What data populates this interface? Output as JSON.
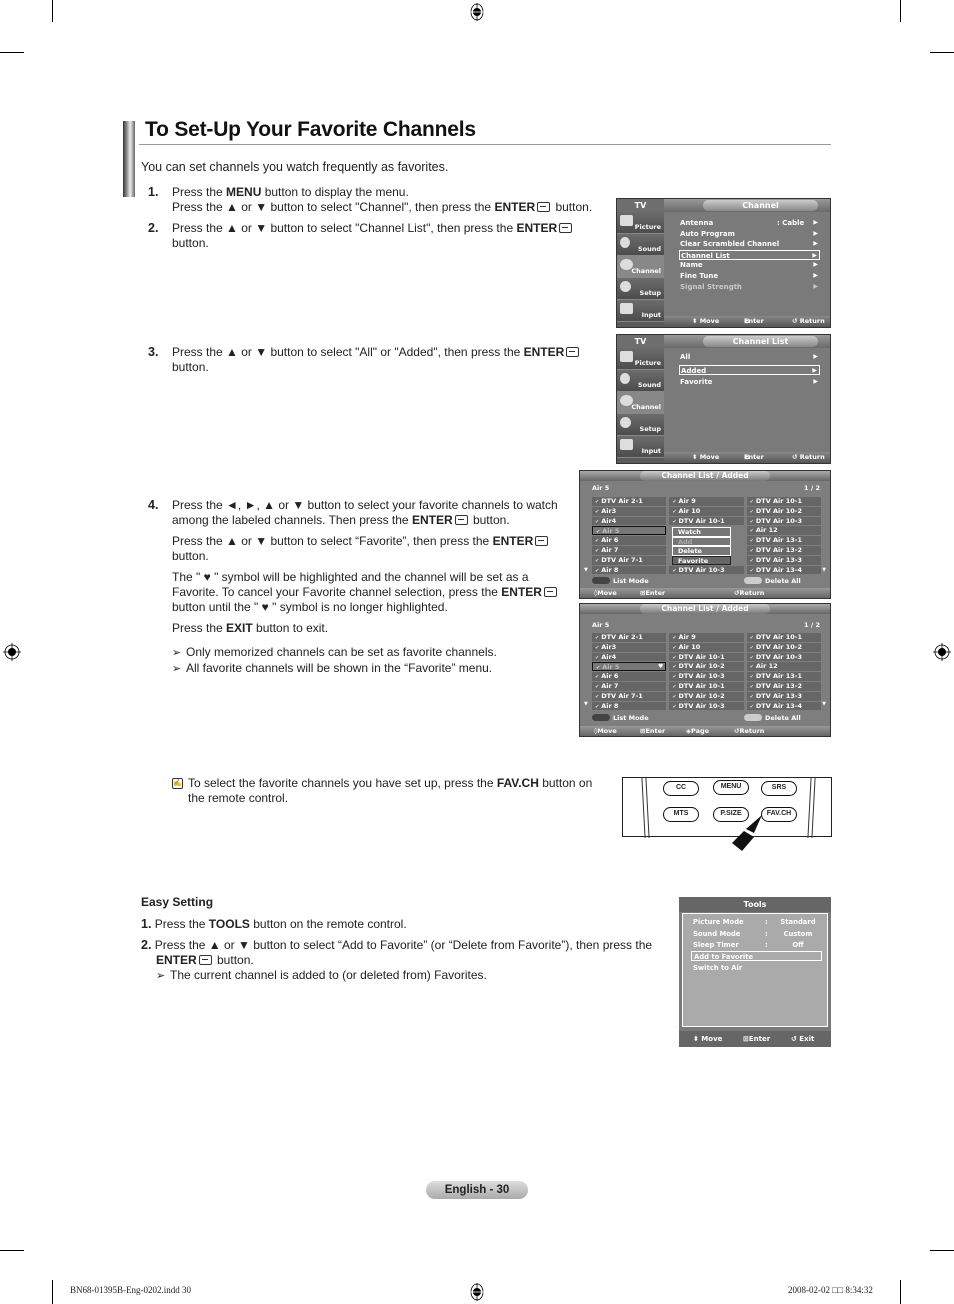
{
  "page": {
    "title": "To Set-Up Your Favorite Channels",
    "intro": "You can set channels you watch frequently as favorites.",
    "page_label": "English - 30",
    "slug_left": "BN68-01395B-Eng-0202.indd   30",
    "slug_right": "2008-02-02   □□ 8:34:32"
  },
  "steps": [
    {
      "num": "1.",
      "lines": [
        {
          "pre": "Press the ",
          "bold": "MENU",
          "post": " button to display the menu."
        },
        {
          "pre": "Press the ▲ or ▼ button to select \"Channel\", then press the ",
          "bold": "ENTER",
          "post": " button."
        }
      ]
    },
    {
      "num": "2.",
      "lines": [
        {
          "pre": "Press the ▲ or ▼ button to select \"Channel List\", then press the ",
          "bold": "ENTER",
          "post": " button."
        }
      ]
    },
    {
      "num": "3.",
      "lines": [
        {
          "pre": "Press the ▲ or ▼ button to select \"All\" or \"Added\", then press the ",
          "bold": "ENTER",
          "post": " button."
        }
      ]
    },
    {
      "num": "4.",
      "paras": [
        {
          "pre": "Press the  ◄, ►, ▲ or ▼ button to select your favorite channels to watch among the labeled channels. Then press the ",
          "bold": "ENTER",
          "post": " button."
        },
        {
          "pre": "Press the ▲ or ▼ button to select “Favorite”, then press the ",
          "bold": "ENTER",
          "post": " button."
        },
        {
          "pre": "The \" ♥ \" symbol will be highlighted and the channel will be set as a Favorite. To cancel your Favorite channel selection, press the ",
          "bold": "ENTER",
          "post": " button until the \" ♥ \" symbol is no longer highlighted."
        },
        {
          "pre": "Press the ",
          "bold": "EXIT",
          "post": " button to exit."
        }
      ],
      "notes": [
        "Only memorized channels can be set as favorite channels.",
        "All favorite channels will be shown in the “Favorite” menu."
      ]
    }
  ],
  "remote_note": {
    "pre": "To select the favorite channels you have set up, press the ",
    "bold": "FAV.CH",
    "post": " button on the remote control."
  },
  "easy_setting": {
    "heading": "Easy Setting",
    "step1": {
      "num": "1.",
      "pre": " Press the ",
      "bold": "TOOLS",
      "post": " button on the remote control."
    },
    "step2": {
      "num": "2.",
      "pre": " Press the ▲ or ▼ button to select “Add to Favorite” (or “Delete from Favorite”), then press the",
      "bold": "ENTER",
      "post": " button."
    },
    "note": "The current channel is added to (or deleted from) Favorites."
  },
  "osd_nav": [
    "Picture",
    "Sound",
    "Channel",
    "Setup",
    "Input"
  ],
  "osd_common": {
    "tv": "TV",
    "move": "⬍ Move",
    "enter": "Enter",
    "return": "↺ Return"
  },
  "osd_channel": {
    "title": "Channel",
    "items": [
      {
        "label": "Antenna",
        "value": ": Cable",
        "arrow": "▶"
      },
      {
        "label": "Auto Program",
        "value": "",
        "arrow": "▶"
      },
      {
        "label": "Clear Scrambled Channel",
        "value": "",
        "arrow": "▶"
      },
      {
        "label": "Channel List",
        "value": "",
        "arrow": "▶",
        "selected": true
      },
      {
        "label": "Name",
        "value": "",
        "arrow": "▶"
      },
      {
        "label": "Fine Tune",
        "value": "",
        "arrow": "▶"
      },
      {
        "label": "Signal Strength",
        "value": "",
        "arrow": "▶",
        "dim": true
      }
    ]
  },
  "osd_channel_list": {
    "title": "Channel List",
    "items": [
      {
        "label": "All",
        "arrow": "▶"
      },
      {
        "label": "Added",
        "arrow": "▶",
        "selected": true
      },
      {
        "label": "Favorite",
        "arrow": "▶"
      }
    ]
  },
  "channel_list_added": {
    "title": "Channel List / Added",
    "current": "Air 5",
    "page": "1 / 2",
    "list_mode": "List Mode",
    "delete_all": "Delete All",
    "foot1": {
      "move": "Move",
      "enter": "Enter",
      "return": "Return"
    },
    "foot2": {
      "move": "Move",
      "enter": "Enter",
      "page": "Page",
      "return": "Return"
    },
    "grid1": [
      "DTV Air 2-1",
      "Air 9",
      "DTV Air 10-1",
      "Air3",
      "Air 10",
      "DTV Air 10-2",
      "Air4",
      "DTV Air 10-1",
      "DTV Air 10-3",
      "Air 5",
      "",
      "Air 12",
      "Air 6",
      "",
      "DTV Air 13-1",
      "Air 7",
      "",
      "DTV Air 13-2",
      "DTV Air 7-1",
      "",
      "DTV Air 13-3",
      "Air 8",
      "DTV Air 10-3",
      "DTV Air 13-4"
    ],
    "popup": [
      "Watch",
      "Add",
      "Delete",
      "Favorite"
    ],
    "grid2": [
      "DTV Air 2-1",
      "Air 9",
      "DTV Air 10-1",
      "Air3",
      "Air 10",
      "DTV Air 10-2",
      "Air4",
      "DTV Air 10-1",
      "DTV Air 10-3",
      "Air 5",
      "DTV Air 10-2",
      "Air 12",
      "Air 6",
      "DTV Air 10-3",
      "DTV Air 13-1",
      "Air 7",
      "DTV Air 10-1",
      "DTV Air 13-2",
      "DTV Air 7-1",
      "DTV Air 10-2",
      "DTV Air 13-3",
      "Air 8",
      "DTV Air 10-3",
      "DTV Air 13-4"
    ]
  },
  "remote_buttons": [
    "CC",
    "MENU",
    "SRS",
    "MTS",
    "P.SIZE",
    "FAV.CH"
  ],
  "tools_menu": {
    "title": "Tools",
    "rows": [
      {
        "label": "Picture Mode",
        "value": "Standard"
      },
      {
        "label": "Sound Mode",
        "value": "Custom"
      },
      {
        "label": "Sleep Timer",
        "value": "Off"
      },
      {
        "label": "Add to Favorite",
        "value": "",
        "selected": true
      },
      {
        "label": "Switch to Air",
        "value": ""
      }
    ],
    "foot": {
      "move": "⬍ Move",
      "enter": "Enter",
      "exit": "↺ Exit"
    }
  }
}
